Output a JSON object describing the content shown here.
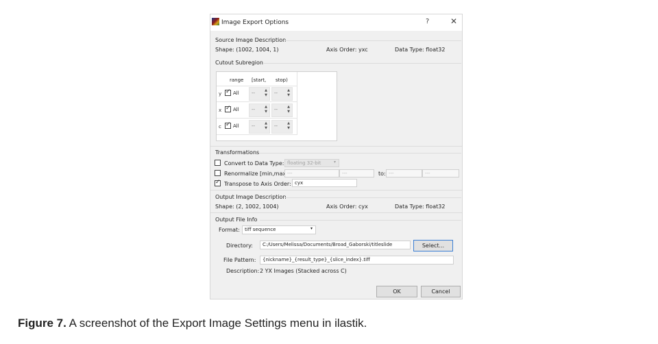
{
  "window": {
    "title": "Image Export Options",
    "help_label": "?",
    "close_label": "✕"
  },
  "source": {
    "heading": "Source Image Description",
    "shape": "Shape:  (1002, 1004, 1)",
    "axis_order": "Axis Order:  yxc",
    "data_type": "Data Type:  float32"
  },
  "cutout": {
    "heading": "Cutout Subregion",
    "columns": [
      "range",
      "[start,",
      "stop)"
    ],
    "rows": [
      {
        "axis": "y",
        "all_label": "All",
        "start": "--",
        "stop": "--",
        "checked": true
      },
      {
        "axis": "x",
        "all_label": "All",
        "start": "--",
        "stop": "--",
        "checked": true
      },
      {
        "axis": "c",
        "all_label": "All",
        "start": "--",
        "stop": "--",
        "checked": true
      }
    ]
  },
  "transformations": {
    "heading": "Transformations",
    "convert_label": "Convert to Data Type:",
    "convert_checked": false,
    "convert_value": "floating 32-bit",
    "renormalize_label": "Renormalize [min,max] from:",
    "renormalize_checked": false,
    "from_min": "---",
    "from_max": "---",
    "to_label": "to:",
    "to_min": "---",
    "to_max": "---",
    "transpose_label": "Transpose to Axis Order:",
    "transpose_checked": true,
    "transpose_value": "cyx"
  },
  "output": {
    "heading": "Output Image Description",
    "shape": "Shape:  (2, 1002, 1004)",
    "axis_order": "Axis Order:  cyx",
    "data_type": "Data Type:  float32"
  },
  "file_info": {
    "heading": "Output File Info",
    "format_label": "Format:",
    "format_value": "tiff sequence",
    "directory_label": "Directory:",
    "directory_value": "C:/Users/Melissa/Documents/Broad_Gaborski/titleslide",
    "select_label": "Select...",
    "pattern_label": "File Pattern:",
    "pattern_value": "{nickname}_{result_type}_{slice_index}.tiff",
    "description_label": "Description:",
    "description_value": "2 YX Images (Stacked across C)"
  },
  "buttons": {
    "ok": "OK",
    "cancel": "Cancel"
  },
  "caption": {
    "figure": "Figure 7.",
    "text": " A screenshot of the Export Image Settings menu in ilastik."
  },
  "icons": [
    "app-icon",
    "help-icon",
    "close-icon",
    "checkbox",
    "spin-arrows-icon",
    "dropdown-arrow-icon"
  ]
}
